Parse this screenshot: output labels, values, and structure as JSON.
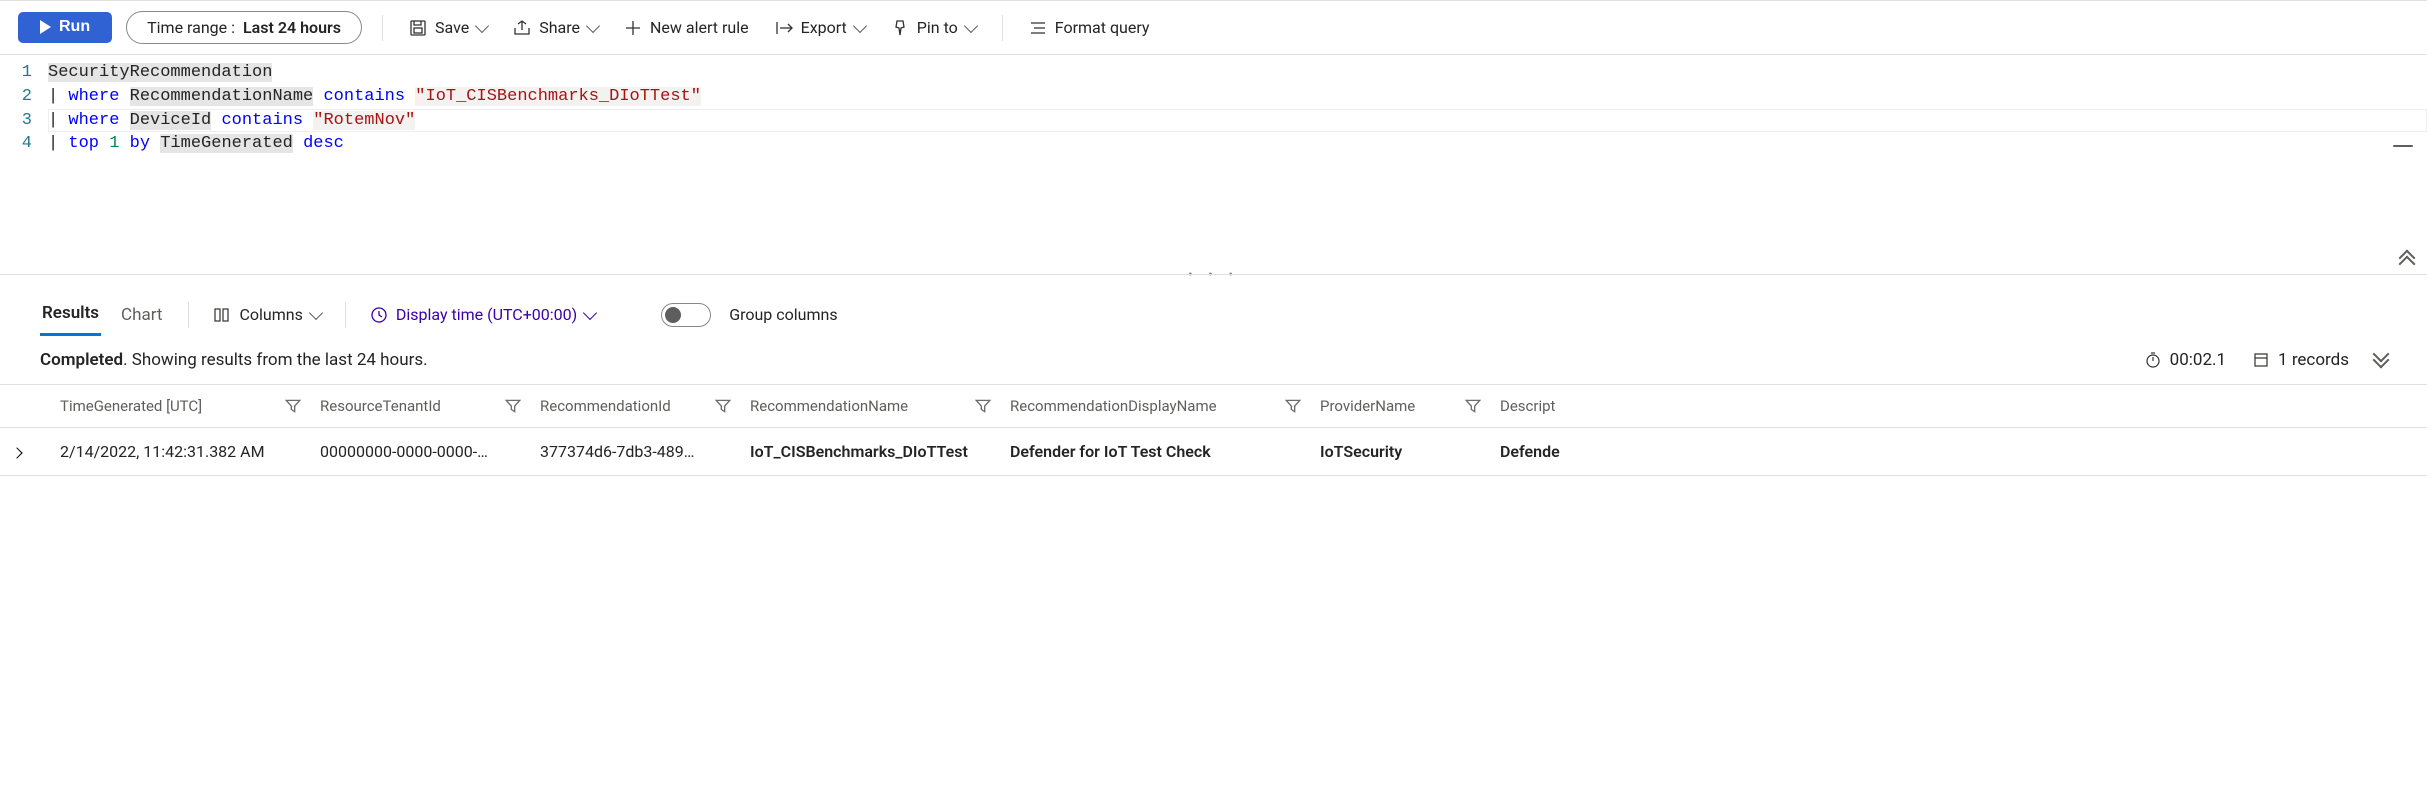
{
  "toolbar": {
    "run_label": "Run",
    "timerange_label": "Time range :",
    "timerange_value": "Last 24 hours",
    "save_label": "Save",
    "share_label": "Share",
    "new_alert_label": "New alert rule",
    "export_label": "Export",
    "pin_label": "Pin to",
    "format_label": "Format query"
  },
  "editor": {
    "lines": [
      {
        "n": "1",
        "plain": "SecurityRecommendation"
      },
      {
        "n": "2",
        "plain": "| where RecommendationName contains \"IoT_CISBenchmarks_DIoTTest\""
      },
      {
        "n": "3",
        "plain": "| where DeviceId contains \"RotemNov\""
      },
      {
        "n": "4",
        "plain": "| top 1 by TimeGenerated desc"
      }
    ],
    "tokens": {
      "l1": {
        "ident": "SecurityRecommendation"
      },
      "l2": {
        "pipe": "|",
        "kw": "where",
        "ident": "RecommendationName",
        "kw2": "contains",
        "str": "\"IoT_CISBenchmarks_DIoTTest\""
      },
      "l3": {
        "pipe": "|",
        "kw": "where",
        "ident": "DeviceId",
        "kw2": "contains",
        "str": "\"RotemNov\""
      },
      "l4": {
        "pipe": "|",
        "kw": "top",
        "num": "1",
        "kw2": "by",
        "ident": "TimeGenerated",
        "kw3": "desc"
      }
    }
  },
  "results_toolbar": {
    "tab_results": "Results",
    "tab_chart": "Chart",
    "columns_label": "Columns",
    "display_time_label": "Display time (UTC+00:00)",
    "group_columns_label": "Group columns"
  },
  "status": {
    "completed_label": "Completed",
    "sep": ". ",
    "showing": "Showing results from the last 24 hours.",
    "duration": "00:02.1",
    "records": "1 records"
  },
  "table": {
    "headers": [
      "TimeGenerated [UTC]",
      "ResourceTenantId",
      "RecommendationId",
      "RecommendationName",
      "RecommendationDisplayName",
      "ProviderName",
      "Descript"
    ],
    "rows": [
      {
        "TimeGenerated": "2/14/2022, 11:42:31.382 AM",
        "ResourceTenantId": "00000000-0000-0000-…",
        "RecommendationId": "377374d6-7db3-489…",
        "RecommendationName": "IoT_CISBenchmarks_DIoTTest",
        "RecommendationDisplayName": "Defender for IoT Test Check",
        "ProviderName": "IoTSecurity",
        "Description": "Defende"
      }
    ]
  }
}
